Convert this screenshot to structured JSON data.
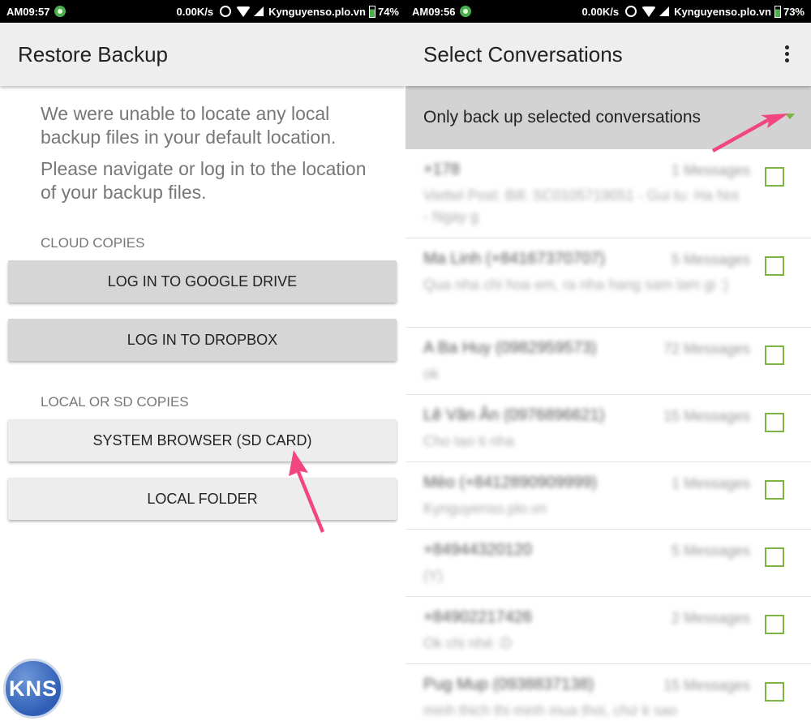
{
  "left": {
    "status": {
      "time": "AM09:57",
      "speed": "0.00K/s",
      "site": "Kynguyenso.plo.vn",
      "battery": "74%"
    },
    "title": "Restore Backup",
    "message": {
      "line1": "We were unable to locate any local backup files in your default location.",
      "line2": "Please navigate or log in to the location of your backup files."
    },
    "cloud_label": "CLOUD COPIES",
    "google_button": "LOG IN TO GOOGLE DRIVE",
    "dropbox_button": "LOG IN TO DROPBOX",
    "local_label": "LOCAL OR SD COPIES",
    "system_browser_button": "SYSTEM BROWSER (SD CARD)",
    "local_folder_button": "LOCAL FOLDER",
    "logo": "KNS"
  },
  "right": {
    "status": {
      "time": "AM09:56",
      "speed": "0.00K/s",
      "site": "Kynguyenso.plo.vn",
      "battery": "73%"
    },
    "title": "Select Conversations",
    "dropdown_value": "Only back up selected conversations",
    "conversations": [
      {
        "name": "+178",
        "count": "1 Messages",
        "snippet": "Viettel Post: Bill: SC0105719051 - Gui tu: Ha Noi - Ngay g"
      },
      {
        "name": "Ma Linh (+84167370707)",
        "count": "5 Messages",
        "snippet": "Qua nha chi hoa em, ra nha hang sam lam gi :)"
      },
      {
        "name": "A Ba Huy (0982959573)",
        "count": "72 Messages",
        "snippet": "ok"
      },
      {
        "name": "Lê Văn Ân (0976896621)",
        "count": "15 Messages",
        "snippet": "Cho tao ti nha"
      },
      {
        "name": "Mèo (+8412890909999)",
        "count": "1 Messages",
        "snippet": "Kynguyenso.plo.vn"
      },
      {
        "name": "+84944320120",
        "count": "5 Messages",
        "snippet": "(Y)"
      },
      {
        "name": "+84902217426",
        "count": "2 Messages",
        "snippet": "Ok chị nhé :D"
      },
      {
        "name": "Pug Mup (0938837138)",
        "count": "15 Messages",
        "snippet": "minh thich thi minh mua thoi, chứ k sao"
      }
    ]
  },
  "colors": {
    "accent_green": "#7cb342",
    "arrow_pink": "#f2467f"
  }
}
